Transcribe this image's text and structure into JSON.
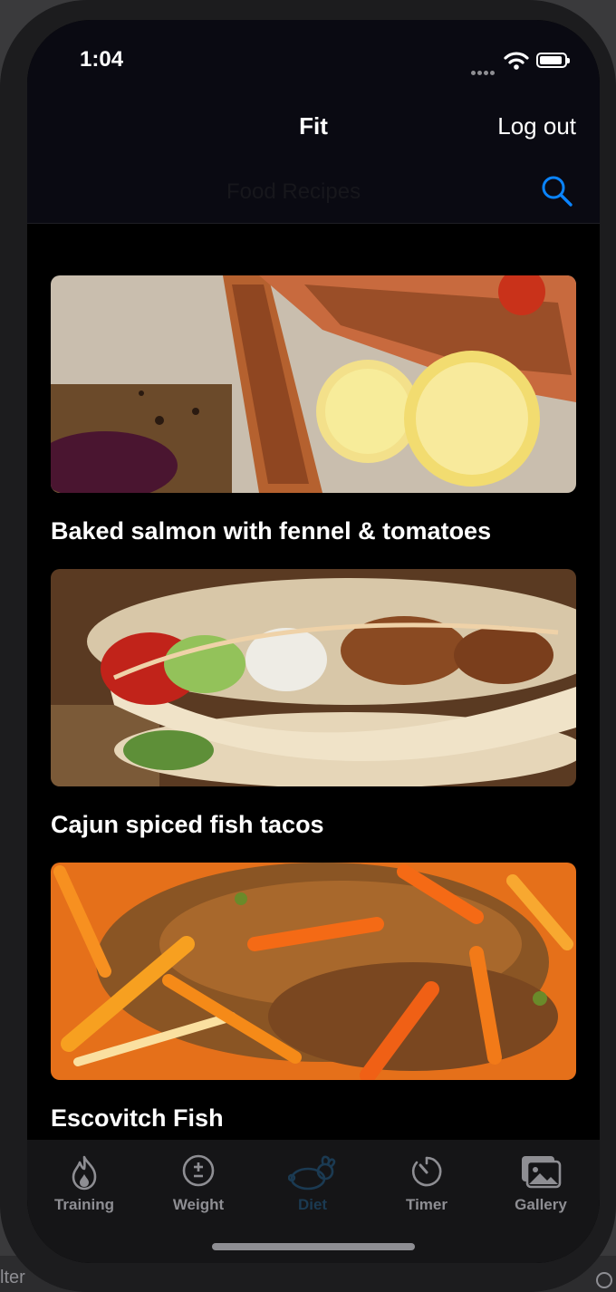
{
  "status_bar": {
    "time": "1:04"
  },
  "nav": {
    "title": "Fit",
    "logout_label": "Log out",
    "search_placeholder": "Food Recipes"
  },
  "recipes": [
    {
      "title": "Baked salmon with fennel & tomatoes"
    },
    {
      "title": "Cajun spiced fish tacos"
    },
    {
      "title": "Escovitch Fish"
    }
  ],
  "tab_bar": {
    "active": "Diet",
    "tabs": [
      {
        "label": "Training",
        "icon": "flame-icon"
      },
      {
        "label": "Weight",
        "icon": "plus-minus-icon"
      },
      {
        "label": "Diet",
        "icon": "rabbit-icon"
      },
      {
        "label": "Timer",
        "icon": "timer-icon"
      },
      {
        "label": "Gallery",
        "icon": "photos-icon"
      }
    ]
  },
  "background": {
    "filter_text": "lter"
  },
  "colors": {
    "accent": "#0a84ff",
    "active_tab": "#1b3a52",
    "inactive_tab": "#8e8e93"
  }
}
